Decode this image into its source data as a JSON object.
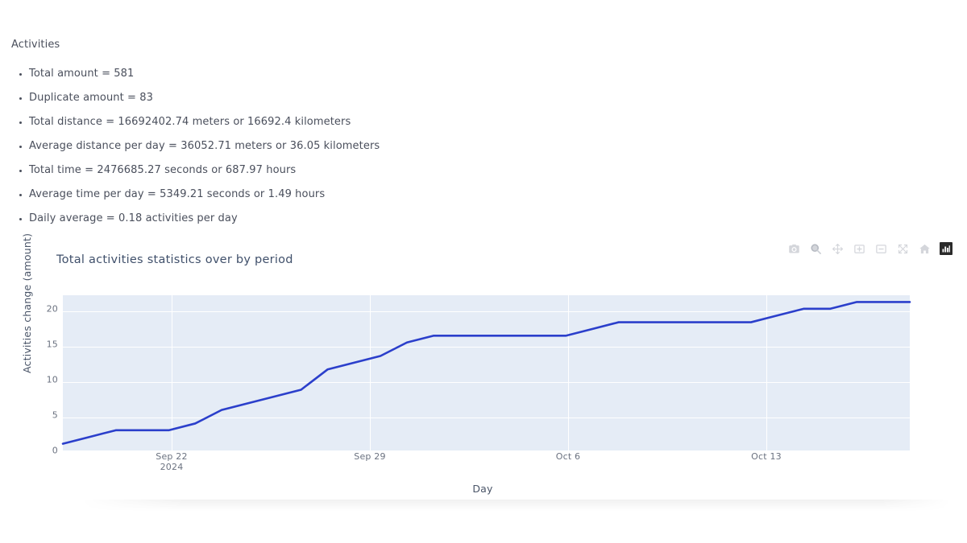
{
  "summary": {
    "heading": "Activities",
    "items": [
      "Total amount = 581",
      "Duplicate amount = 83",
      "Total distance = 16692402.74 meters or 16692.4 kilometers",
      "Average distance per day = 36052.71 meters or 36.05 kilometers",
      "Total time = 2476685.27 seconds or 687.97 hours",
      "Average time per day = 5349.21 seconds or 1.49 hours",
      "Daily average = 0.18 activities per day"
    ]
  },
  "modebar": {
    "buttons": [
      {
        "name": "camera-icon",
        "title": "Download plot as a png"
      },
      {
        "name": "zoom-magnifier-icon",
        "title": "Zoom"
      },
      {
        "name": "pan-move-icon",
        "title": "Pan"
      },
      {
        "name": "zoom-in-icon",
        "title": "Zoom in"
      },
      {
        "name": "zoom-out-icon",
        "title": "Zoom out"
      },
      {
        "name": "autoscale-icon",
        "title": "Autoscale"
      },
      {
        "name": "home-reset-axes-icon",
        "title": "Reset axes"
      },
      {
        "name": "plotly-logo-icon",
        "title": "Produced with Plotly"
      }
    ]
  },
  "colors": {
    "line": "#2B3FCB",
    "plot_background": "#E5ECF6",
    "gridline": "#FFFFFF",
    "title_text": "#40506B",
    "tick_text": "#6B7280"
  },
  "chart_data": {
    "type": "line",
    "title": "Total activities statistics over by period",
    "xlabel": "Day",
    "ylabel": "Activities change (amount)",
    "grid": true,
    "legend": "none",
    "ylim": [
      0,
      23
    ],
    "xlim": [
      "2024-09-18",
      "2024-10-20"
    ],
    "ytick_values": [
      0,
      5,
      10,
      15,
      20
    ],
    "xtick_labels": [
      {
        "label": "Sep 22",
        "sub": "2024",
        "x": "2024-09-22"
      },
      {
        "label": "Sep 29",
        "sub": "",
        "x": "2024-09-29"
      },
      {
        "label": "Oct 6",
        "sub": "",
        "x": "2024-10-06"
      },
      {
        "label": "Oct 13",
        "sub": "",
        "x": "2024-10-13"
      }
    ],
    "series": [
      {
        "name": "Activities change (amount)",
        "color": "#2B3FCB",
        "x": [
          "2024-09-18",
          "2024-09-19",
          "2024-09-20",
          "2024-09-21",
          "2024-09-22",
          "2024-09-23",
          "2024-09-24",
          "2024-09-25",
          "2024-09-26",
          "2024-09-27",
          "2024-09-28",
          "2024-09-29",
          "2024-09-30",
          "2024-10-01",
          "2024-10-02",
          "2024-10-03",
          "2024-10-04",
          "2024-10-05",
          "2024-10-06",
          "2024-10-07",
          "2024-10-08",
          "2024-10-09",
          "2024-10-10",
          "2024-10-11",
          "2024-10-12",
          "2024-10-13",
          "2024-10-14",
          "2024-10-15",
          "2024-10-16",
          "2024-10-17",
          "2024-10-18",
          "2024-10-19",
          "2024-10-20"
        ],
        "y": [
          1,
          2,
          3,
          3,
          3,
          4,
          6,
          7,
          8,
          9,
          12,
          13,
          14,
          16,
          17,
          17,
          17,
          17,
          17,
          17,
          18,
          19,
          19,
          19,
          19,
          19,
          19,
          20,
          21,
          21,
          22,
          22,
          22
        ]
      }
    ]
  }
}
